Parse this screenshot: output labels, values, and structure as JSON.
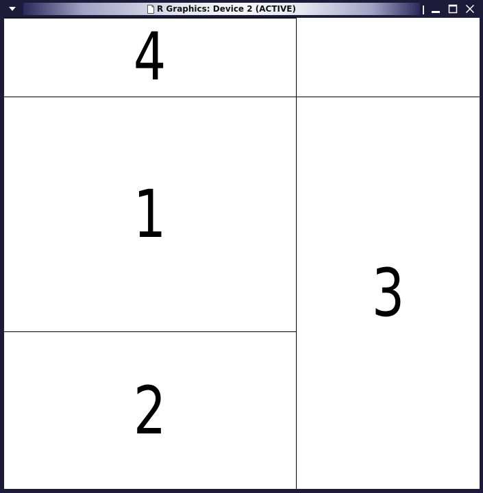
{
  "window": {
    "title": "R Graphics: Device 2 (ACTIVE)",
    "title_icon": "document-icon",
    "menu_icon": "triangle-down-icon",
    "controls": {
      "minimize_icon": "minimize-icon",
      "maximize_icon": "maximize-icon",
      "close_icon": "close-icon"
    },
    "colors": {
      "frame": "#1c1c3a",
      "canvas": "#ffffff",
      "lines": "#000000"
    }
  },
  "plot_panels": {
    "panel_4": {
      "label": "4"
    },
    "panel_1": {
      "label": "1"
    },
    "panel_2": {
      "label": "2"
    },
    "panel_3": {
      "label": "3"
    },
    "panel_empty": {
      "label": ""
    }
  }
}
